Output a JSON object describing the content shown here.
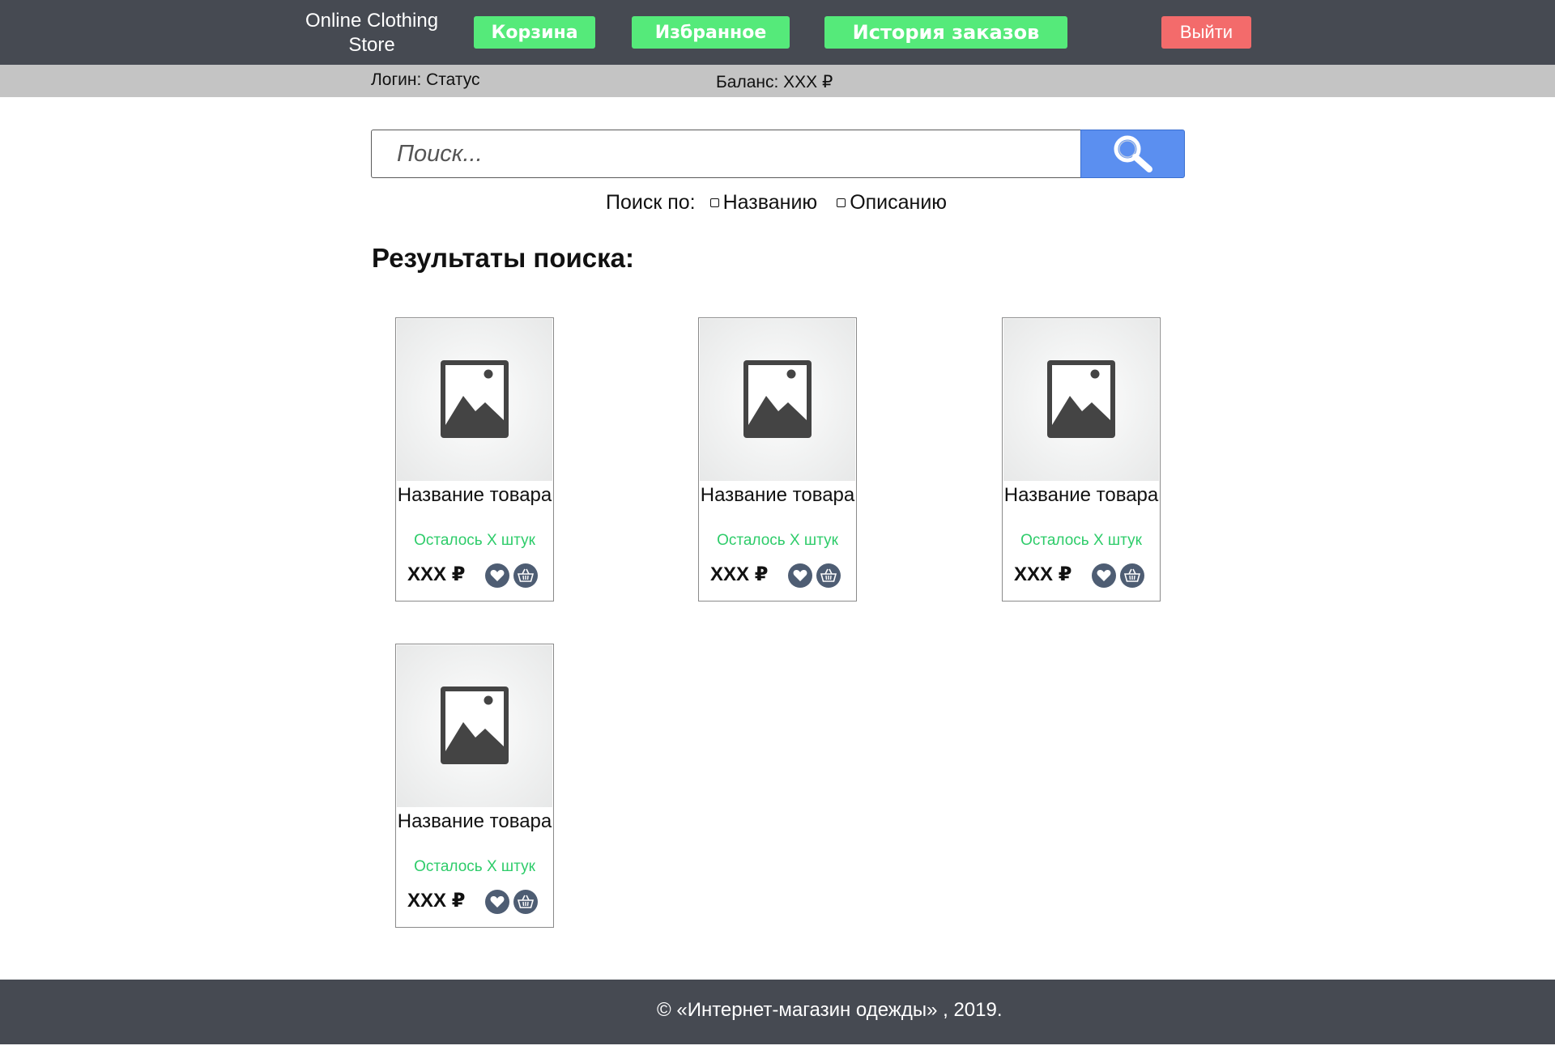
{
  "header": {
    "brand": "Online Clothing Store",
    "nav": {
      "cart_label": "Корзина",
      "favorites_label": "Избранное",
      "history_label": "История заказов"
    },
    "logout_label": "Выйти",
    "colors": {
      "background": "#464a52",
      "nav_button": "#55ea7a",
      "logout_button": "#f36b6b"
    }
  },
  "info_bar": {
    "login": "Логин: Статус",
    "balance": "Баланс: XXX ₽"
  },
  "search": {
    "placeholder": "Поиск...",
    "button_icon": "search-icon",
    "button_color": "#5b8ff0",
    "by_label": "Поиск по:",
    "options": [
      {
        "label": "Названию",
        "checked": false
      },
      {
        "label": "Описанию",
        "checked": false
      }
    ]
  },
  "results": {
    "heading": "Результаты поиска:",
    "products": [
      {
        "image_icon": "image-placeholder-icon",
        "name": "Название товара",
        "stock": "Осталось X штук",
        "price": "XXX ₽"
      },
      {
        "image_icon": "image-placeholder-icon",
        "name": "Название товара",
        "stock": "Осталось X штук",
        "price": "XXX ₽"
      },
      {
        "image_icon": "image-placeholder-icon",
        "name": "Название товара",
        "stock": "Осталось X штук",
        "price": "XXX ₽"
      },
      {
        "image_icon": "image-placeholder-icon",
        "name": "Название товара",
        "stock": "Осталось X штук",
        "price": "XXX ₽"
      }
    ],
    "stock_color": "#2ecc6a"
  },
  "footer": {
    "text": "© «Интернет-магазин одежды» , 2019."
  }
}
